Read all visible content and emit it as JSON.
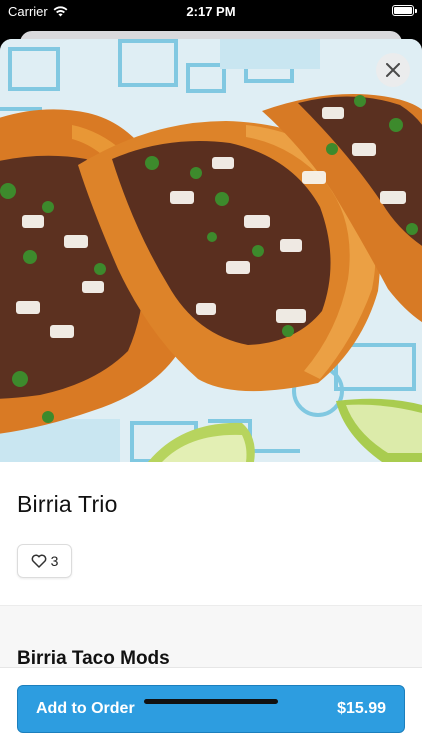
{
  "status_bar": {
    "carrier": "Carrier",
    "time": "2:17 PM"
  },
  "item": {
    "title": "Birria Trio",
    "like_count": "3",
    "image_icon": "tacos-photo"
  },
  "sections": {
    "mods_title": "Birria Taco Mods"
  },
  "footer": {
    "add_label": "Add to Order",
    "price": "$15.99"
  },
  "colors": {
    "accent": "#2d9de0",
    "accent_border": "#1c7fbd"
  }
}
